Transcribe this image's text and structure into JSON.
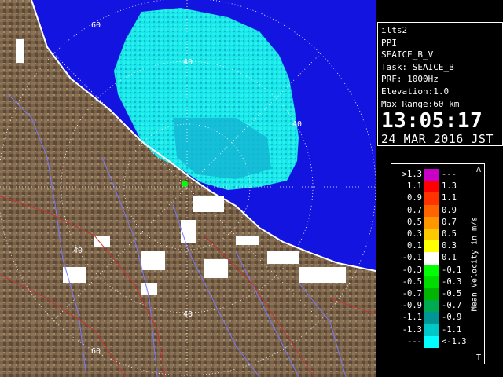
{
  "radar": {
    "range_labels": [
      "60",
      "40",
      "40",
      "40",
      "40",
      "60"
    ],
    "colors": {
      "land": "#7a6248",
      "sea": "#1414e0",
      "echo_main": "#19e6e6",
      "echo_dark": "#13b4d2",
      "coastline": "#ffffff",
      "river": "#7878ff",
      "boundary": "#c83232",
      "rings": "#ffffff"
    }
  },
  "info": {
    "lines": [
      "ilts2",
      "PPI",
      "SEAICE_B_V",
      "Task: SEAICE_B",
      "PRF: 1000Hz",
      "Elevation:1.0",
      "Max Range:60 km"
    ],
    "time": "13:05:17",
    "date": "24 MAR 2016 JST"
  },
  "legend": {
    "title": "Mean Velocity in m/s",
    "top_mark": "A",
    "bottom_mark": "T",
    "rows": [
      {
        "left": ">1.3",
        "right": "---",
        "color": "#c800c8"
      },
      {
        "left": "1.1",
        "right": "1.3",
        "color": "#ff0000"
      },
      {
        "left": "0.9",
        "right": "1.1",
        "color": "#ff3200"
      },
      {
        "left": "0.7",
        "right": "0.9",
        "color": "#ff6400"
      },
      {
        "left": "0.5",
        "right": "0.7",
        "color": "#ff9600"
      },
      {
        "left": "0.3",
        "right": "0.5",
        "color": "#ffc800"
      },
      {
        "left": "0.1",
        "right": "0.3",
        "color": "#ffff00"
      },
      {
        "left": "-0.1",
        "right": "0.1",
        "color": "#ffffff"
      },
      {
        "left": "-0.3",
        "right": "-0.1",
        "color": "#00ff00"
      },
      {
        "left": "-0.5",
        "right": "-0.3",
        "color": "#00dc00"
      },
      {
        "left": "-0.7",
        "right": "-0.5",
        "color": "#00b400"
      },
      {
        "left": "-0.9",
        "right": "-0.7",
        "color": "#00aa50"
      },
      {
        "left": "-1.1",
        "right": "-0.9",
        "color": "#009696"
      },
      {
        "left": "-1.3",
        "right": "-1.1",
        "color": "#00c8c8"
      },
      {
        "left": "---",
        "right": "<-1.3",
        "color": "#00ffff"
      }
    ]
  }
}
